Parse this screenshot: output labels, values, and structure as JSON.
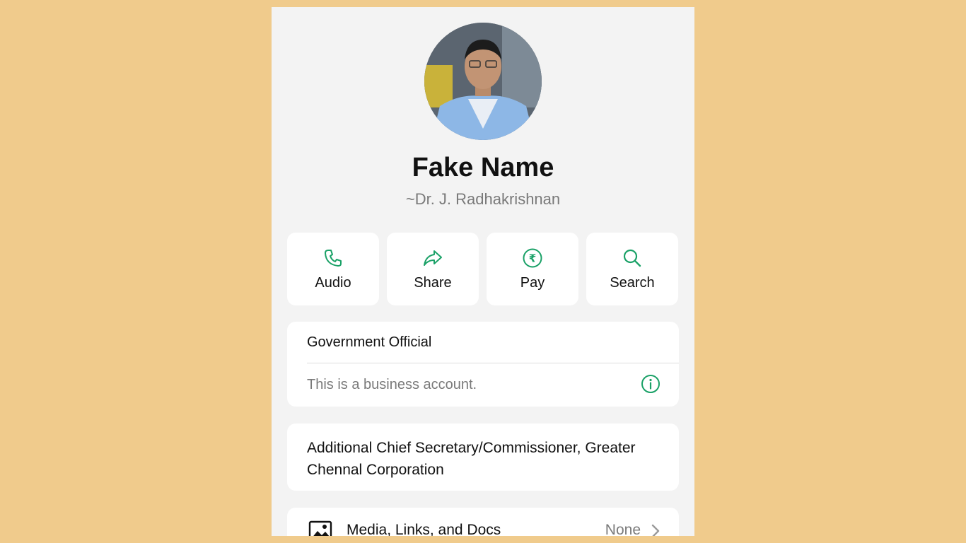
{
  "profile": {
    "name": "Fake Name",
    "subname": "~Dr. J. Radhakrishnan"
  },
  "actions": [
    {
      "label": "Audio",
      "icon": "phone-icon"
    },
    {
      "label": "Share",
      "icon": "share-icon"
    },
    {
      "label": "Pay",
      "icon": "rupee-icon"
    },
    {
      "label": "Search",
      "icon": "search-icon"
    }
  ],
  "business": {
    "category": "Government Official",
    "note": "This is a business account."
  },
  "description": "Additional Chief Secretary/Commissioner, Greater Chennal Corporation",
  "media": {
    "label": "Media, Links, and Docs",
    "value": "None"
  },
  "colors": {
    "accent": "#1aa167",
    "background": "#f0cb8c",
    "panel": "#f3f3f3"
  }
}
